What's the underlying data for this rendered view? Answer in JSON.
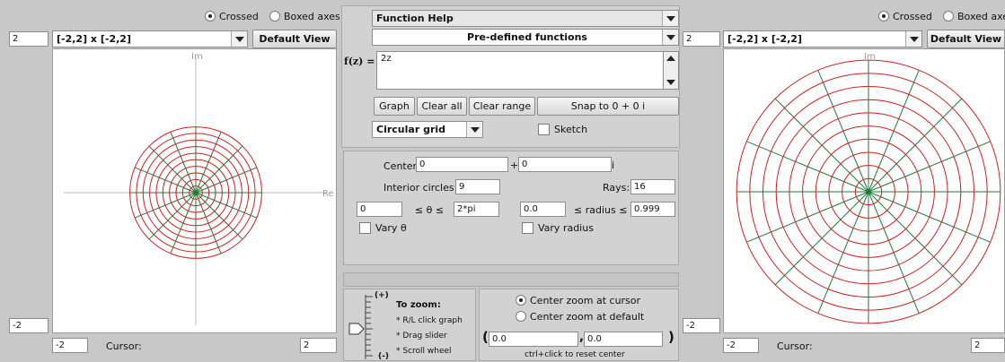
{
  "left_plot": {
    "mode_crossed": "Crossed",
    "mode_boxed": "Boxed axes",
    "range": "[-2,2] x [-2,2]",
    "default_view": "Default View",
    "ymax": "2",
    "ymin": "-2",
    "xmin": "-2",
    "xmax": "2",
    "cursor_label": "Cursor:",
    "im_label": "Im",
    "re_label": "Re"
  },
  "right_plot": {
    "mode_crossed": "Crossed",
    "mode_boxed": "Boxed axes",
    "range": "[-2,2] x [-2,2]",
    "default_view": "Default View",
    "ymax": "2",
    "ymin": "-2",
    "xmin": "-2",
    "xmax": "2",
    "cursor_label": "Cursor:",
    "im_label": "Im"
  },
  "center": {
    "function_help": "Function Help",
    "predefined": "Pre-defined functions",
    "fz_label": "f(z) =",
    "fz_value": "2z",
    "graph": "Graph",
    "clear_all": "Clear all",
    "clear_range": "Clear range",
    "snap": "Snap to 0 + 0 i",
    "grid_type": "Circular grid",
    "sketch": "Sketch",
    "center_label": "Center:",
    "center_re": "0",
    "plus": "+",
    "center_im": "0",
    "i_label": "i",
    "interior_label": "Interior circles:",
    "interior_value": "9",
    "rays_label": "Rays:",
    "rays_value": "16",
    "theta_min": "0",
    "theta_leq": "≤ θ ≤",
    "theta_max": "2*pi",
    "radius_min": "0.0",
    "radius_leq": "≤ radius ≤",
    "radius_max": "0.999",
    "vary_theta": "Vary θ",
    "vary_radius": "Vary radius"
  },
  "zoom": {
    "plus": "(+)",
    "minus": "(-)",
    "to_zoom": "To zoom:",
    "hint1": "* R/L click graph",
    "hint2": "* Drag slider",
    "hint3": "* Scroll wheel",
    "center_cursor": "Center zoom at cursor",
    "center_default": "Center zoom at default",
    "open_paren": "(",
    "re": "0.0",
    "comma": ",",
    "im": "0.0",
    "close_paren": ")",
    "reset_hint": "ctrl+click to reset center"
  },
  "colors": {
    "circle": "#d02020",
    "ray": "#1f7a3a",
    "axis": "#b8b8b8"
  },
  "grid": {
    "interior_circles": 9,
    "rays": 16,
    "left_radius": 0.999,
    "right_radius": 1.998
  }
}
